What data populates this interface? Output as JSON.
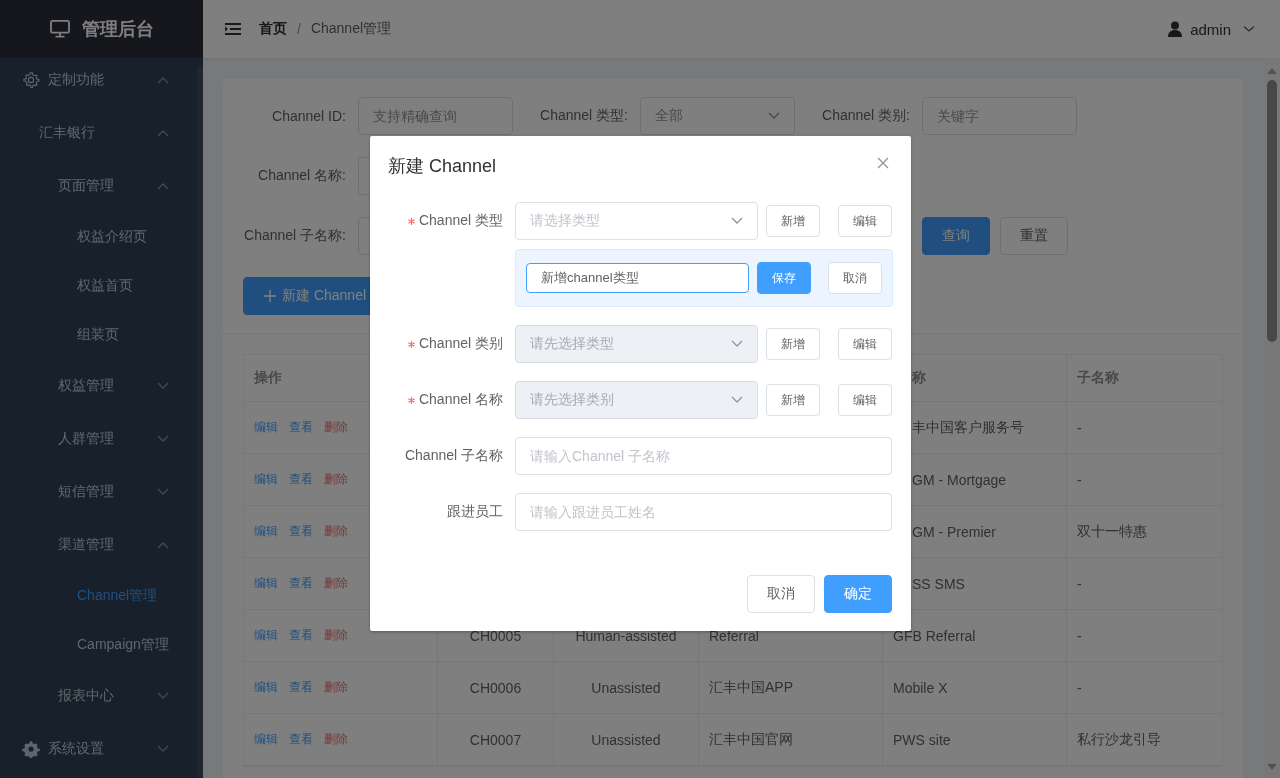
{
  "app": {
    "logo": "管理后台"
  },
  "header": {
    "breadcrumb": [
      {
        "label": "首页",
        "current": false
      },
      {
        "label": "Channel管理",
        "current": true
      }
    ],
    "separator": "/",
    "user": "admin"
  },
  "sidebar": {
    "items": [
      {
        "label": "定制功能",
        "selected": false,
        "expanded": true,
        "children": [
          {
            "label": "汇丰银行",
            "selected": false,
            "expanded": true,
            "children": [
              {
                "label": "页面管理",
                "selected": false,
                "expanded": true,
                "children": [
                  {
                    "label": "权益介绍页",
                    "selected": false
                  },
                  {
                    "label": "权益首页",
                    "selected": false
                  },
                  {
                    "label": "组装页",
                    "selected": false
                  }
                ]
              },
              {
                "label": "权益管理",
                "selected": false,
                "expanded": false
              },
              {
                "label": "人群管理",
                "selected": false,
                "expanded": false
              },
              {
                "label": "短信管理",
                "selected": false,
                "expanded": false
              },
              {
                "label": "渠道管理",
                "selected": false,
                "expanded": true,
                "children": [
                  {
                    "label": "Channel管理",
                    "selected": true
                  },
                  {
                    "label": "Campaign管理",
                    "selected": false
                  }
                ]
              },
              {
                "label": "报表中心",
                "selected": false,
                "expanded": false
              }
            ]
          }
        ]
      },
      {
        "label": "系统设置",
        "selected": false,
        "expanded": false
      }
    ]
  },
  "filters": {
    "rows": [
      {
        "fields": [
          {
            "label": "Channel ID:",
            "kind": "input",
            "placeholder": "支持精确查询"
          },
          {
            "label": "Channel 类型:",
            "kind": "select",
            "value": "全部"
          },
          {
            "label": "Channel 类别:",
            "kind": "input",
            "placeholder": "关键字"
          }
        ]
      },
      {
        "fields": [
          {
            "label": "Channel 名称:",
            "kind": "input"
          }
        ]
      },
      {
        "fields": [
          {
            "label": "Channel 子名称:",
            "kind": "input"
          }
        ],
        "buttons": [
          {
            "label": "查询",
            "primary": true
          },
          {
            "label": "重置",
            "primary": false
          }
        ]
      }
    ]
  },
  "new_button": {
    "label": "新建 Channel"
  },
  "table": {
    "header": {
      "column_1": "操作",
      "column_5": "称",
      "column_6": "子名称"
    },
    "rows": [
      {
        "actions": [
          {
            "label": "编辑",
            "kind": "link"
          },
          {
            "label": "查看",
            "kind": "link"
          },
          {
            "label": "删除",
            "kind": "danger"
          }
        ],
        "column_5": "丰中国客户服务号",
        "column_6": "-"
      },
      {
        "actions": [
          {
            "label": "编辑",
            "kind": "link"
          },
          {
            "label": "查看",
            "kind": "link"
          },
          {
            "label": "删除",
            "kind": "danger"
          }
        ],
        "column_5": "GM - Mortgage",
        "column_6": "-"
      },
      {
        "actions": [
          {
            "label": "编辑",
            "kind": "link"
          },
          {
            "label": "查看",
            "kind": "link"
          },
          {
            "label": "删除",
            "kind": "danger"
          }
        ],
        "column_5": "GM - Premier",
        "column_6": "双十一特惠"
      },
      {
        "actions": [
          {
            "label": "编辑",
            "kind": "link"
          },
          {
            "label": "查看",
            "kind": "link"
          },
          {
            "label": "删除",
            "kind": "danger"
          }
        ],
        "column_5": "SS SMS",
        "column_6": "-"
      },
      {
        "actions": [
          {
            "label": "编辑",
            "kind": "link"
          },
          {
            "label": "查看",
            "kind": "link"
          },
          {
            "label": "删除",
            "kind": "danger"
          }
        ],
        "column_2": "CH0005",
        "column_3": "Human-assisted",
        "column_4": "Referral",
        "column_5": "GFB Referral",
        "column_6": "-"
      },
      {
        "actions": [
          {
            "label": "编辑",
            "kind": "link"
          },
          {
            "label": "查看",
            "kind": "link"
          },
          {
            "label": "删除",
            "kind": "danger"
          }
        ],
        "column_2": "CH0006",
        "column_3": "Unassisted",
        "column_4": "汇丰中国APP",
        "column_5": "Mobile X",
        "column_6": "-"
      },
      {
        "actions": [
          {
            "label": "编辑",
            "kind": "link"
          },
          {
            "label": "查看",
            "kind": "link"
          },
          {
            "label": "删除",
            "kind": "danger"
          }
        ],
        "column_2": "CH0007",
        "column_3": "Unassisted",
        "column_4": "汇丰中国官网",
        "column_5": "PWS site",
        "column_6": "私行沙龙引导"
      }
    ]
  },
  "dialog": {
    "title": "新建 Channel",
    "fields": [
      {
        "label": "Channel 类型",
        "required": true,
        "kind": "select",
        "placeholder": "请选择类型",
        "disabled": false,
        "buttons": [
          "新增",
          "编辑"
        ],
        "add_panel": {
          "value": "新增channel类型",
          "focused": true,
          "buttons": [
            {
              "label": "保存",
              "primary": true
            },
            {
              "label": "取消",
              "primary": false
            }
          ]
        }
      },
      {
        "label": "Channel 类别",
        "required": true,
        "kind": "select",
        "placeholder": "请先选择类型",
        "disabled": true,
        "buttons": [
          "新增",
          "编辑"
        ]
      },
      {
        "label": "Channel 名称",
        "required": true,
        "kind": "select",
        "placeholder": "请先选择类别",
        "disabled": true,
        "buttons": [
          "新增",
          "编辑"
        ]
      },
      {
        "label": "Channel 子名称",
        "required": false,
        "kind": "input",
        "placeholder": "请输入Channel 子名称"
      },
      {
        "label": "跟进员工",
        "required": false,
        "kind": "input",
        "placeholder": "请输入跟进员工姓名"
      }
    ],
    "footer_buttons": [
      {
        "label": "取消",
        "primary": false
      },
      {
        "label": "确定",
        "primary": true
      }
    ]
  }
}
